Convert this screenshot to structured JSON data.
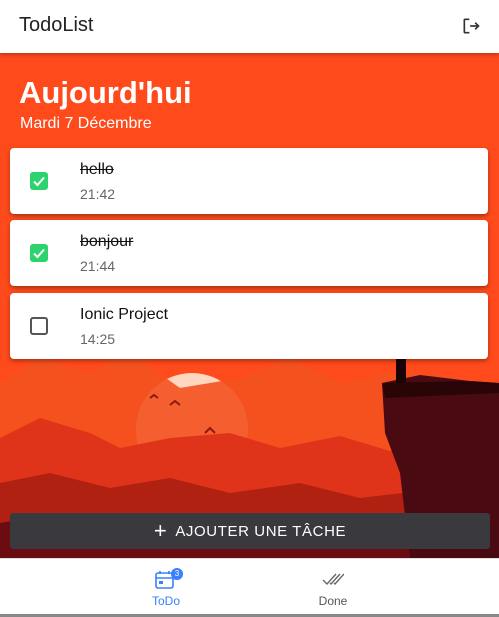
{
  "app": {
    "title": "TodoList"
  },
  "header": {
    "title": "Aujourd'hui",
    "date": "Mardi 7 Décembre"
  },
  "tasks": [
    {
      "name": "hello",
      "time": "21:42",
      "done": true
    },
    {
      "name": "bonjour",
      "time": "21:44",
      "done": true
    },
    {
      "name": "Ionic Project",
      "time": "14:25",
      "done": false
    }
  ],
  "add_button": {
    "label": "AJOUTER UNE TÂCHE"
  },
  "tabs": [
    {
      "label": "ToDo",
      "badge": "3",
      "active": true,
      "icon": "calendar-icon"
    },
    {
      "label": "Done",
      "active": false,
      "icon": "double-check-icon"
    }
  ],
  "colors": {
    "primary_bg": "#ff4a1c",
    "active_tab": "#3880ff",
    "checkbox": "#2dd36f",
    "button": "#3a3a3e"
  },
  "icons": {
    "logout": "logout-icon"
  }
}
